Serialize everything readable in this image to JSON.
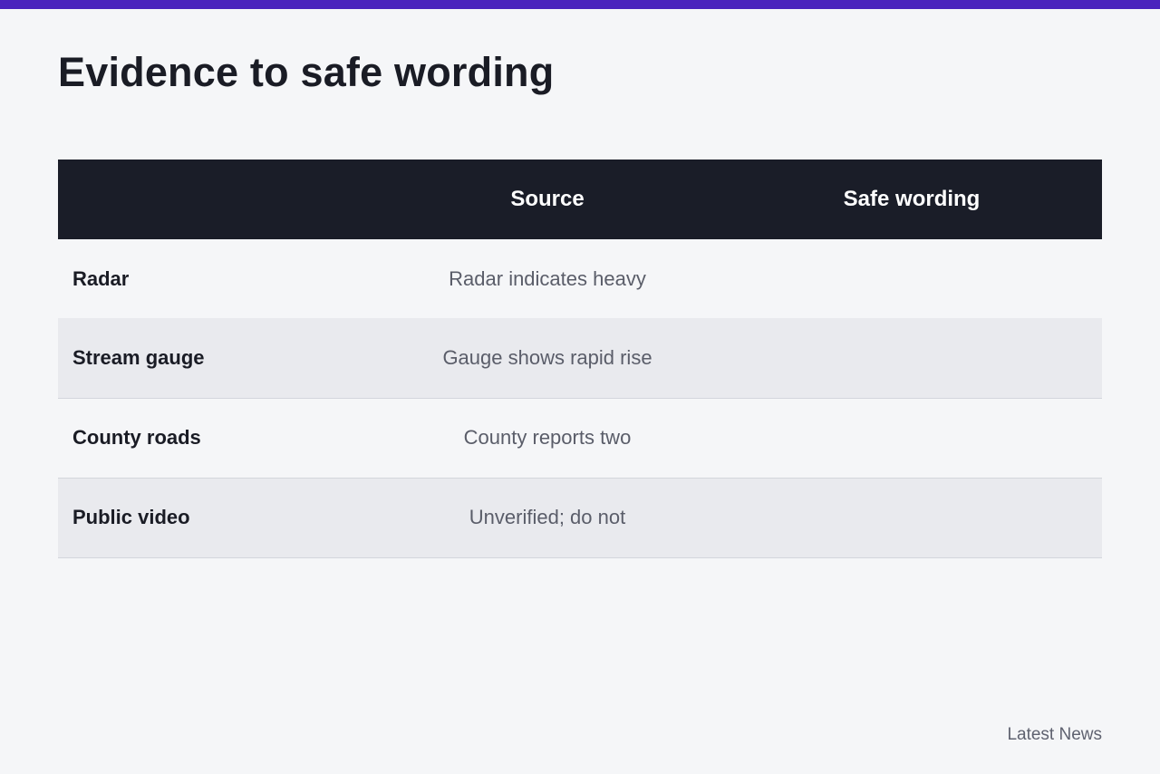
{
  "page": {
    "title": "Evidence to safe wording",
    "footer": "Latest News"
  },
  "colors": {
    "accent_bar": "#4a22bd",
    "header_bg": "#1a1d28",
    "row_alt_bg": "#e9eaee",
    "page_bg": "#f5f6f8"
  },
  "table": {
    "columns": [
      "",
      "Source",
      "Safe wording"
    ],
    "rows": [
      {
        "label": "Radar",
        "source": "Radar indicates heavy",
        "wording": ""
      },
      {
        "label": "Stream gauge",
        "source": "Gauge shows rapid rise",
        "wording": ""
      },
      {
        "label": "County roads",
        "source": "County reports two",
        "wording": ""
      },
      {
        "label": "Public video",
        "source": "Unverified; do not",
        "wording": ""
      }
    ]
  }
}
